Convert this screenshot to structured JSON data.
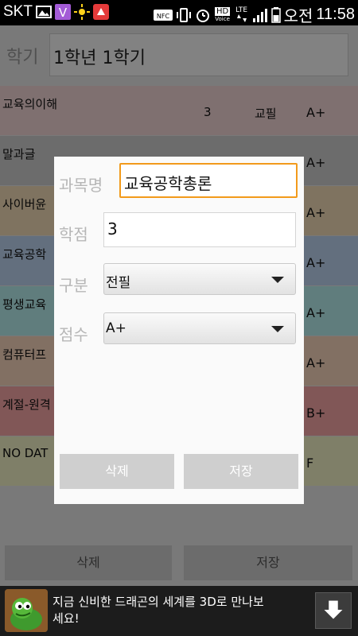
{
  "status_bar": {
    "carrier": "SKT",
    "nfc": "NFC",
    "hd_voice": "HD",
    "hd_voice_sub": "Voice",
    "lte": "LTE",
    "am_pm": "오전",
    "time": "11:58"
  },
  "semester": {
    "label": "학기",
    "value": "1학년 1학기"
  },
  "courses": [
    {
      "name": "교육의이해",
      "credit": "3",
      "category": "교필",
      "grade": "A+",
      "color": "#f3d7d7"
    },
    {
      "name": "말과글",
      "credit": "",
      "category": "",
      "grade": "A+",
      "color": "#d0d0d0"
    },
    {
      "name": "사이버윤",
      "credit": "",
      "category": "",
      "grade": "A+",
      "color": "#f3ddb9"
    },
    {
      "name": "교육공학",
      "credit": "",
      "category": "",
      "grade": "A+",
      "color": "#bfd5f1"
    },
    {
      "name": "평생교육",
      "credit": "",
      "category": "",
      "grade": "A+",
      "color": "#b9efef"
    },
    {
      "name": "컴퓨터프",
      "credit": "",
      "category": "",
      "grade": "A+",
      "color": "#fad6bf"
    },
    {
      "name": "계절-원격",
      "credit": "",
      "category": "",
      "grade": "B+",
      "color": "#f7a7a7"
    },
    {
      "name": "NO DAT",
      "credit": "",
      "category": "",
      "grade": "F",
      "color": "#f3f3c7"
    }
  ],
  "bottom_buttons": {
    "delete_label": "삭제",
    "save_label": "저장"
  },
  "dialog": {
    "subject_label": "과목명",
    "subject_value": "교육공학총론",
    "credit_label": "학점",
    "credit_value": "3",
    "category_label": "구분",
    "category_value": "전필",
    "grade_label": "점수",
    "grade_value": "A+",
    "delete_label": "삭제",
    "save_label": "저장"
  },
  "ad": {
    "text": "지금 신비한 드래곤의 세계를 3D로 만나보세요!"
  },
  "colors": {
    "focus": "#f29a1b",
    "dialog_bg": "#fafafa",
    "app_bg": "#e8e8e8"
  }
}
